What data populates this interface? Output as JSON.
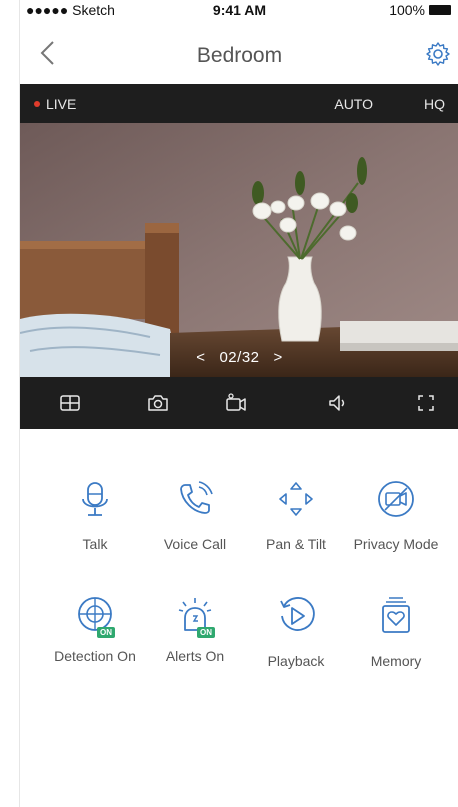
{
  "status_bar": {
    "carrier": "●●●●● Sketch",
    "time": "9:41 AM",
    "battery": "100%"
  },
  "nav": {
    "title": "Bedroom"
  },
  "live_bar": {
    "live_label": "LIVE",
    "auto_label": "AUTO",
    "hq_label": "HQ"
  },
  "video": {
    "prev": "<",
    "counter": "02/32",
    "next": ">"
  },
  "toolbar": {
    "icons": [
      "grid-icon",
      "camera-icon",
      "video-record-icon",
      "volume-icon",
      "fullscreen-icon"
    ]
  },
  "actions": [
    {
      "label": "Talk",
      "icon": "microphone-icon"
    },
    {
      "label": "Voice Call",
      "icon": "phone-icon"
    },
    {
      "label": "Pan & Tilt",
      "icon": "pan-tilt-icon"
    },
    {
      "label": "Privacy Mode",
      "icon": "privacy-icon"
    },
    {
      "label": "Detection On",
      "icon": "detection-icon",
      "badge": "ON"
    },
    {
      "label": "Alerts On",
      "icon": "alert-icon",
      "badge": "ON"
    },
    {
      "label": "Playback",
      "icon": "playback-icon"
    },
    {
      "label": "Memory",
      "icon": "memory-icon"
    }
  ],
  "colors": {
    "accent": "#3b7ac4",
    "badge": "#2fa86f",
    "bar": "#1e1e1e",
    "live_dot": "#e03c2c"
  }
}
